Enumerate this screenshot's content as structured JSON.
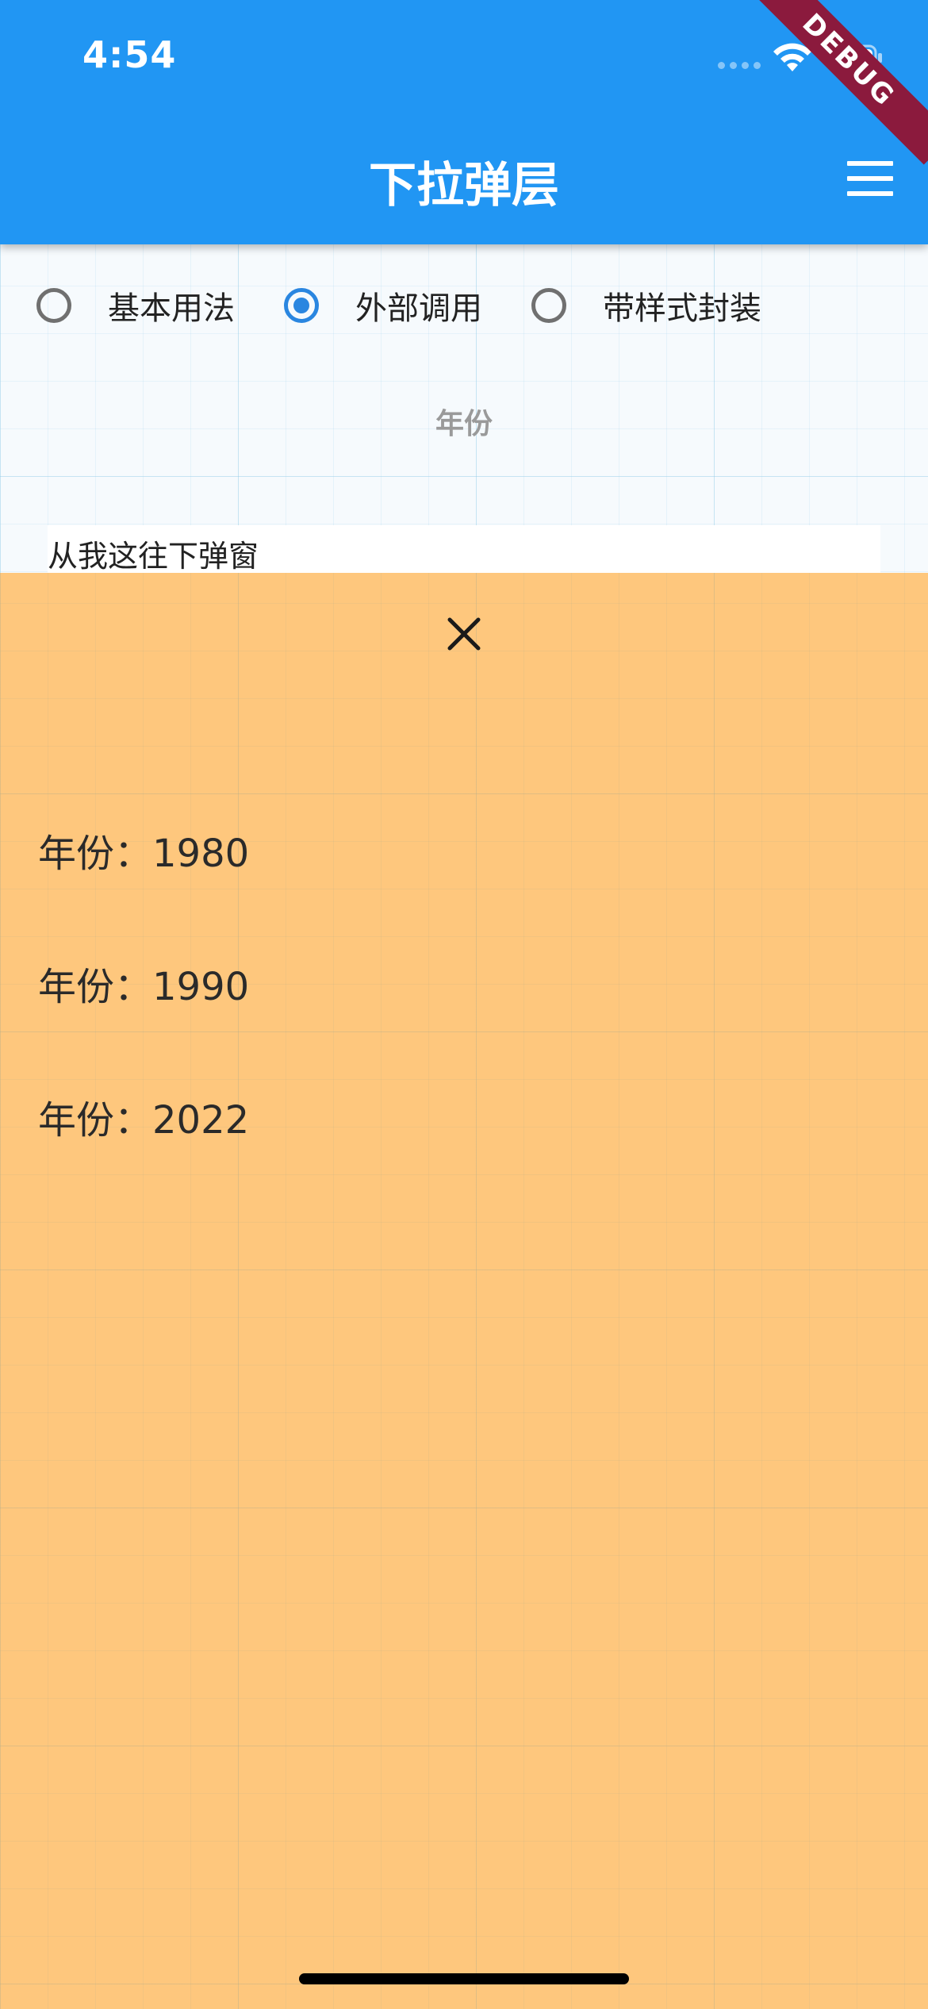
{
  "status_bar": {
    "time": "4:54"
  },
  "app_bar": {
    "title": "下拉弹层",
    "debug_banner": "DEBUG"
  },
  "radio_options": [
    {
      "label": "基本用法",
      "selected": false
    },
    {
      "label": "外部调用",
      "selected": true
    },
    {
      "label": "带样式封装",
      "selected": false
    }
  ],
  "filter": {
    "label": "年份",
    "trigger_text": "从我这往下弹窗"
  },
  "dropdown": {
    "background_color": "#fec77d",
    "items": [
      {
        "label": "年份：1980"
      },
      {
        "label": "年份：1990"
      },
      {
        "label": "年份：2022"
      }
    ]
  },
  "colors": {
    "app_bar": "#2196f3",
    "radio_selected": "#2a86e0",
    "debug_banner": "#8b1a3d"
  }
}
